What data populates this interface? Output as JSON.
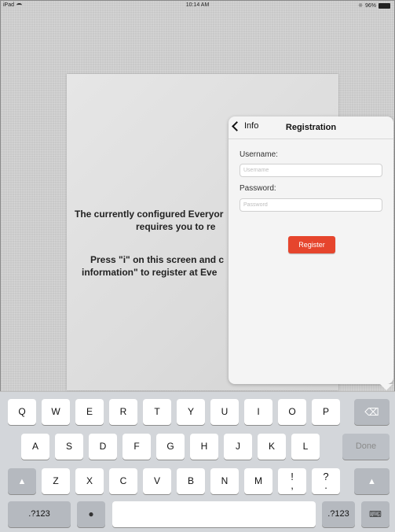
{
  "status_bar": {
    "device": "iPad",
    "time": "10:14 AM",
    "battery": "96%"
  },
  "background_message": {
    "line1": "The currently configured Everyor",
    "line2": "requires you to re",
    "line3": "Press \"i\" on this screen and c",
    "line4": "information\" to register at Eve"
  },
  "popover": {
    "back_label": "Info",
    "title": "Registration",
    "username_label": "Username:",
    "username_placeholder": "Username",
    "password_label": "Password:",
    "password_placeholder": "Password",
    "register_label": "Register"
  },
  "keyboard": {
    "row1": [
      "Q",
      "W",
      "E",
      "R",
      "T",
      "Y",
      "U",
      "I",
      "O",
      "P"
    ],
    "row2": [
      "A",
      "S",
      "D",
      "F",
      "G",
      "H",
      "J",
      "K",
      "L"
    ],
    "done_label": "Done",
    "row3": [
      "Z",
      "X",
      "C",
      "V",
      "B",
      "N",
      "M"
    ],
    "excl_top": "!",
    "excl_bottom": ",",
    "quest_top": "?",
    "quest_bottom": ".",
    "numbers_label": ".?123"
  },
  "colors": {
    "accent": "#e6452d",
    "keyboard_bg": "#d3d6da"
  }
}
